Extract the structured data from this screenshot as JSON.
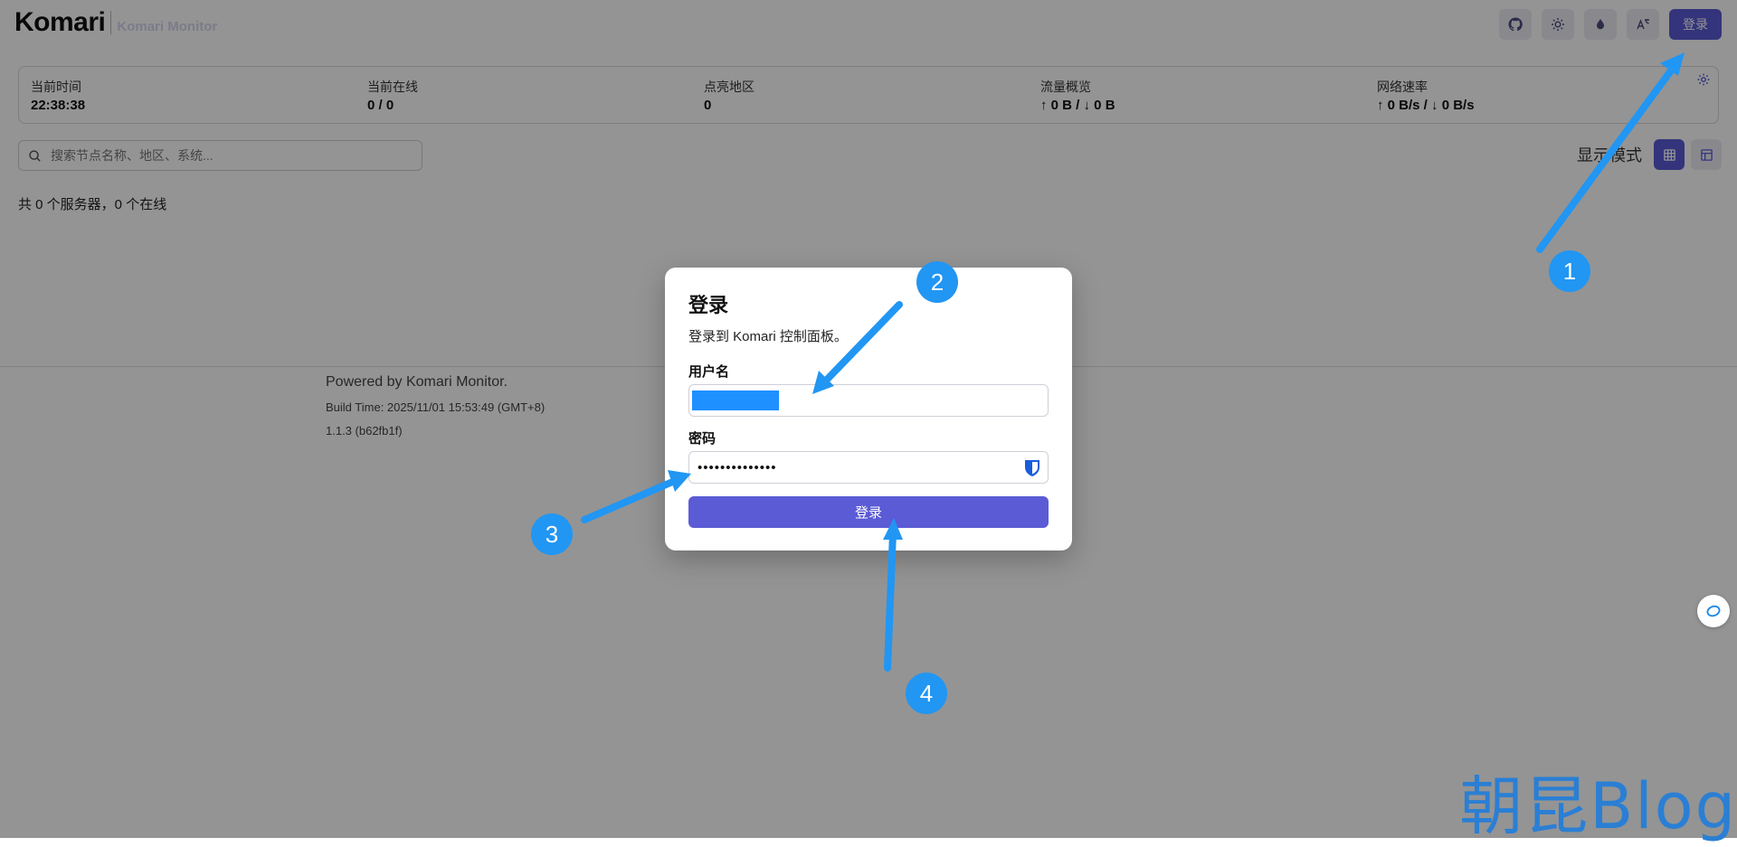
{
  "app": {
    "name": "Komari",
    "subtitle": "Komari Monitor"
  },
  "header": {
    "icons": [
      "github-icon",
      "sun-icon",
      "droplet-icon",
      "translate-icon"
    ],
    "login_label": "登录"
  },
  "stats": {
    "items": [
      {
        "label": "当前时间",
        "value": "22:38:38"
      },
      {
        "label": "当前在线",
        "value": "0 / 0"
      },
      {
        "label": "点亮地区",
        "value": "0"
      },
      {
        "label": "流量概览",
        "value": "↑ 0 B / ↓ 0 B"
      },
      {
        "label": "网络速率",
        "value": "↑ 0 B/s / ↓ 0 B/s"
      }
    ]
  },
  "search": {
    "placeholder": "搜索节点名称、地区、系统..."
  },
  "view": {
    "label": "显示模式"
  },
  "summary": "共 0 个服务器，0 个在线",
  "footer": {
    "powered": "Powered by Komari Monitor.",
    "build": "Build Time: 2025/11/01 15:53:49 (GMT+8)",
    "version": "1.1.3 (b62fb1f)"
  },
  "dialog": {
    "title": "登录",
    "description": "登录到 Komari 控制面板。",
    "username_label": "用户名",
    "password_label": "密码",
    "password_mask": "••••••••••••••",
    "submit_label": "登录"
  },
  "annotations": [
    "1",
    "2",
    "3",
    "4"
  ],
  "watermark": "朝昆Blog",
  "colors": {
    "accent": "#5b5bd6",
    "annotation": "#2196f3",
    "redaction": "#1e90ff"
  }
}
